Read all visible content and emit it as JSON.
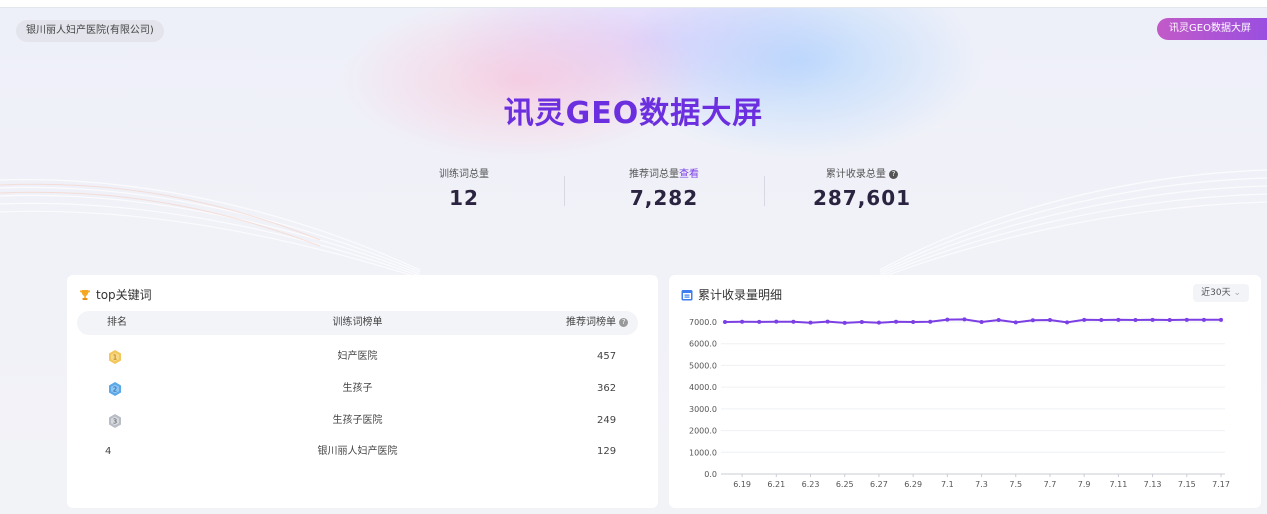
{
  "header": {
    "hospital_name": "银川丽人妇产医院(有限公司)",
    "screen_button": "讯灵GEO数据大屏",
    "title": "讯灵GEO数据大屏"
  },
  "stats": [
    {
      "label": "训练词总量",
      "value": "12"
    },
    {
      "label": "推荐词总量",
      "link": "查看",
      "value": "7,282"
    },
    {
      "label": "累计收录总量",
      "value": "287,601"
    }
  ],
  "colors": {
    "accent": "#6b2fe0",
    "line": "#7b3fe4",
    "button": "#9a4fe0"
  },
  "keywords_card": {
    "title": "top关键词",
    "icon": "trophy-icon",
    "columns": [
      "排名",
      "训练词榜单",
      "推荐词榜单"
    ],
    "rows": [
      {
        "rank": "1",
        "word": "妇产医院",
        "count": "457",
        "medal": "gold"
      },
      {
        "rank": "2",
        "word": "生孩子",
        "count": "362",
        "medal": "blue"
      },
      {
        "rank": "3",
        "word": "生孩子医院",
        "count": "249",
        "medal": "silver"
      },
      {
        "rank": "4",
        "word": "银川丽人妇产医院",
        "count": "129",
        "medal": "none"
      }
    ]
  },
  "chart_card": {
    "title": "累计收录量明细",
    "icon": "calendar-icon",
    "range_select": "近30天"
  },
  "chart_data": {
    "type": "line",
    "x": [
      "6.18",
      "6.19",
      "6.20",
      "6.21",
      "6.22",
      "6.23",
      "6.24",
      "6.25",
      "6.26",
      "6.27",
      "6.28",
      "6.29",
      "6.30",
      "7.1",
      "7.2",
      "7.3",
      "7.4",
      "7.5",
      "7.6",
      "7.7",
      "7.8",
      "7.9",
      "7.10",
      "7.11",
      "7.12",
      "7.13",
      "7.14",
      "7.15",
      "7.16",
      "7.17"
    ],
    "x_tick_labels": [
      "6.19",
      "6.21",
      "6.23",
      "6.25",
      "6.27",
      "6.29",
      "7.1",
      "7.3",
      "7.5",
      "7.7",
      "7.9",
      "7.11",
      "7.13",
      "7.15",
      "7.17"
    ],
    "y_tick_labels": [
      "0.0",
      "1000.0",
      "2000.0",
      "3000.0",
      "4000.0",
      "5000.0",
      "6000.0",
      "7000.0"
    ],
    "ylim": [
      0,
      7000
    ],
    "series": [
      {
        "values": [
          7000,
          7010,
          7005,
          7015,
          7010,
          6970,
          7020,
          6960,
          7000,
          6970,
          7010,
          7000,
          7010,
          7110,
          7120,
          7000,
          7090,
          6980,
          7080,
          7090,
          6980,
          7100,
          7090,
          7100,
          7090,
          7100,
          7090,
          7100,
          7100,
          7100
        ]
      }
    ],
    "grid": true
  }
}
